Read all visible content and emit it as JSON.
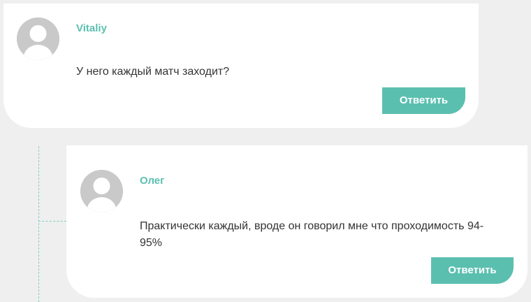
{
  "comments": [
    {
      "author": "Vitaliy",
      "text": "У него каждый матч заходит?",
      "reply_label": "Ответить"
    },
    {
      "author": "Олег",
      "text": "Практически каждый, вроде он говорил мне что проходимость 94-95%",
      "reply_label": "Ответить"
    }
  ],
  "colors": {
    "accent": "#5bbfb0",
    "card": "#ffffff",
    "background": "#efefef",
    "avatar": "#c9c9c9"
  },
  "icons": {
    "avatar": "default-user-avatar-icon"
  }
}
